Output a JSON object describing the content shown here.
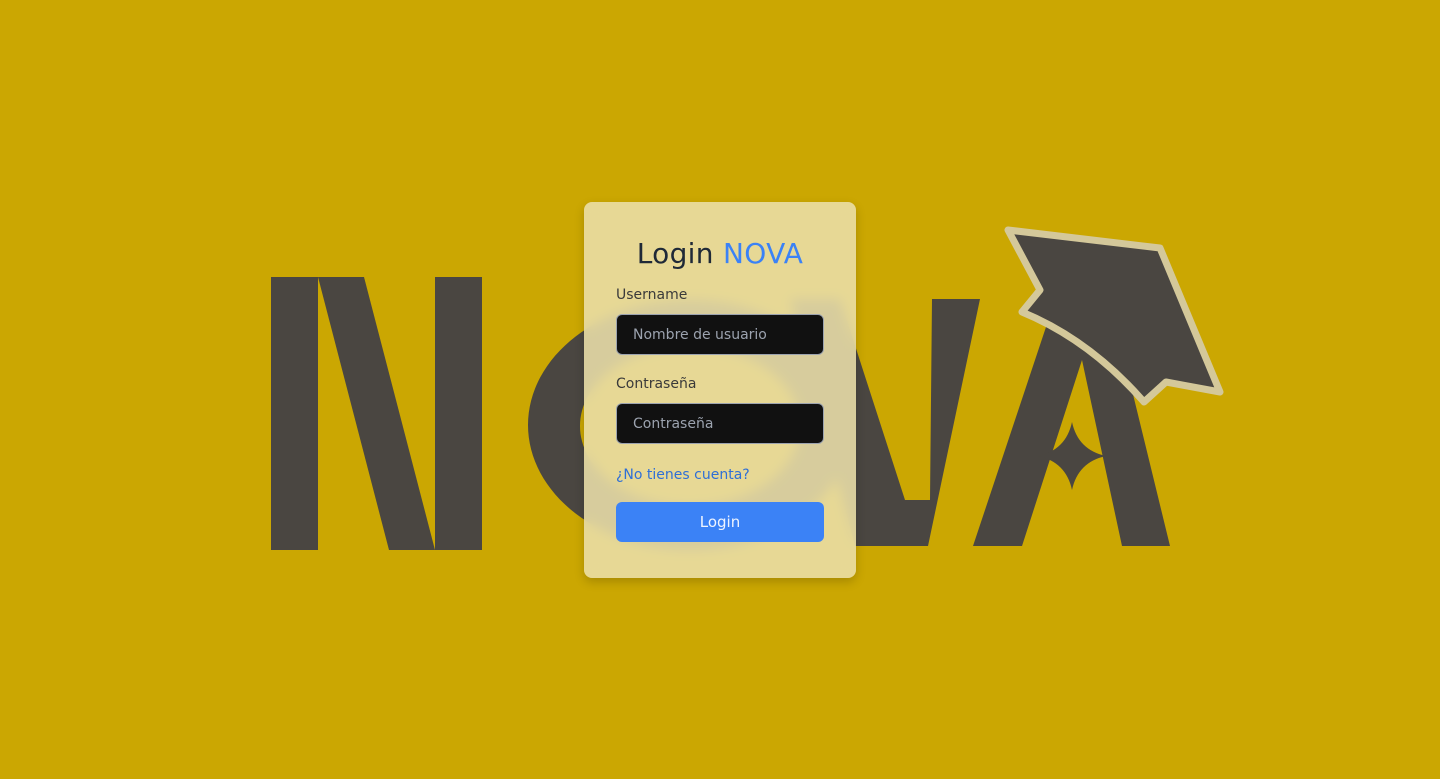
{
  "background": {
    "color": "#cba702",
    "logo_text": "NOVA",
    "logo_color": "#4a4641",
    "cap_border_color": "#d4c89a"
  },
  "login": {
    "title_prefix": "Login",
    "title_brand": "NOVA",
    "brand_color": "#3b82f6",
    "username_label": "Username",
    "username_placeholder": "Nombre de usuario",
    "username_value": "",
    "password_label": "Contraseña",
    "password_placeholder": "Contraseña",
    "password_value": "",
    "register_link": "¿No tienes cuenta?",
    "submit_label": "Login"
  }
}
